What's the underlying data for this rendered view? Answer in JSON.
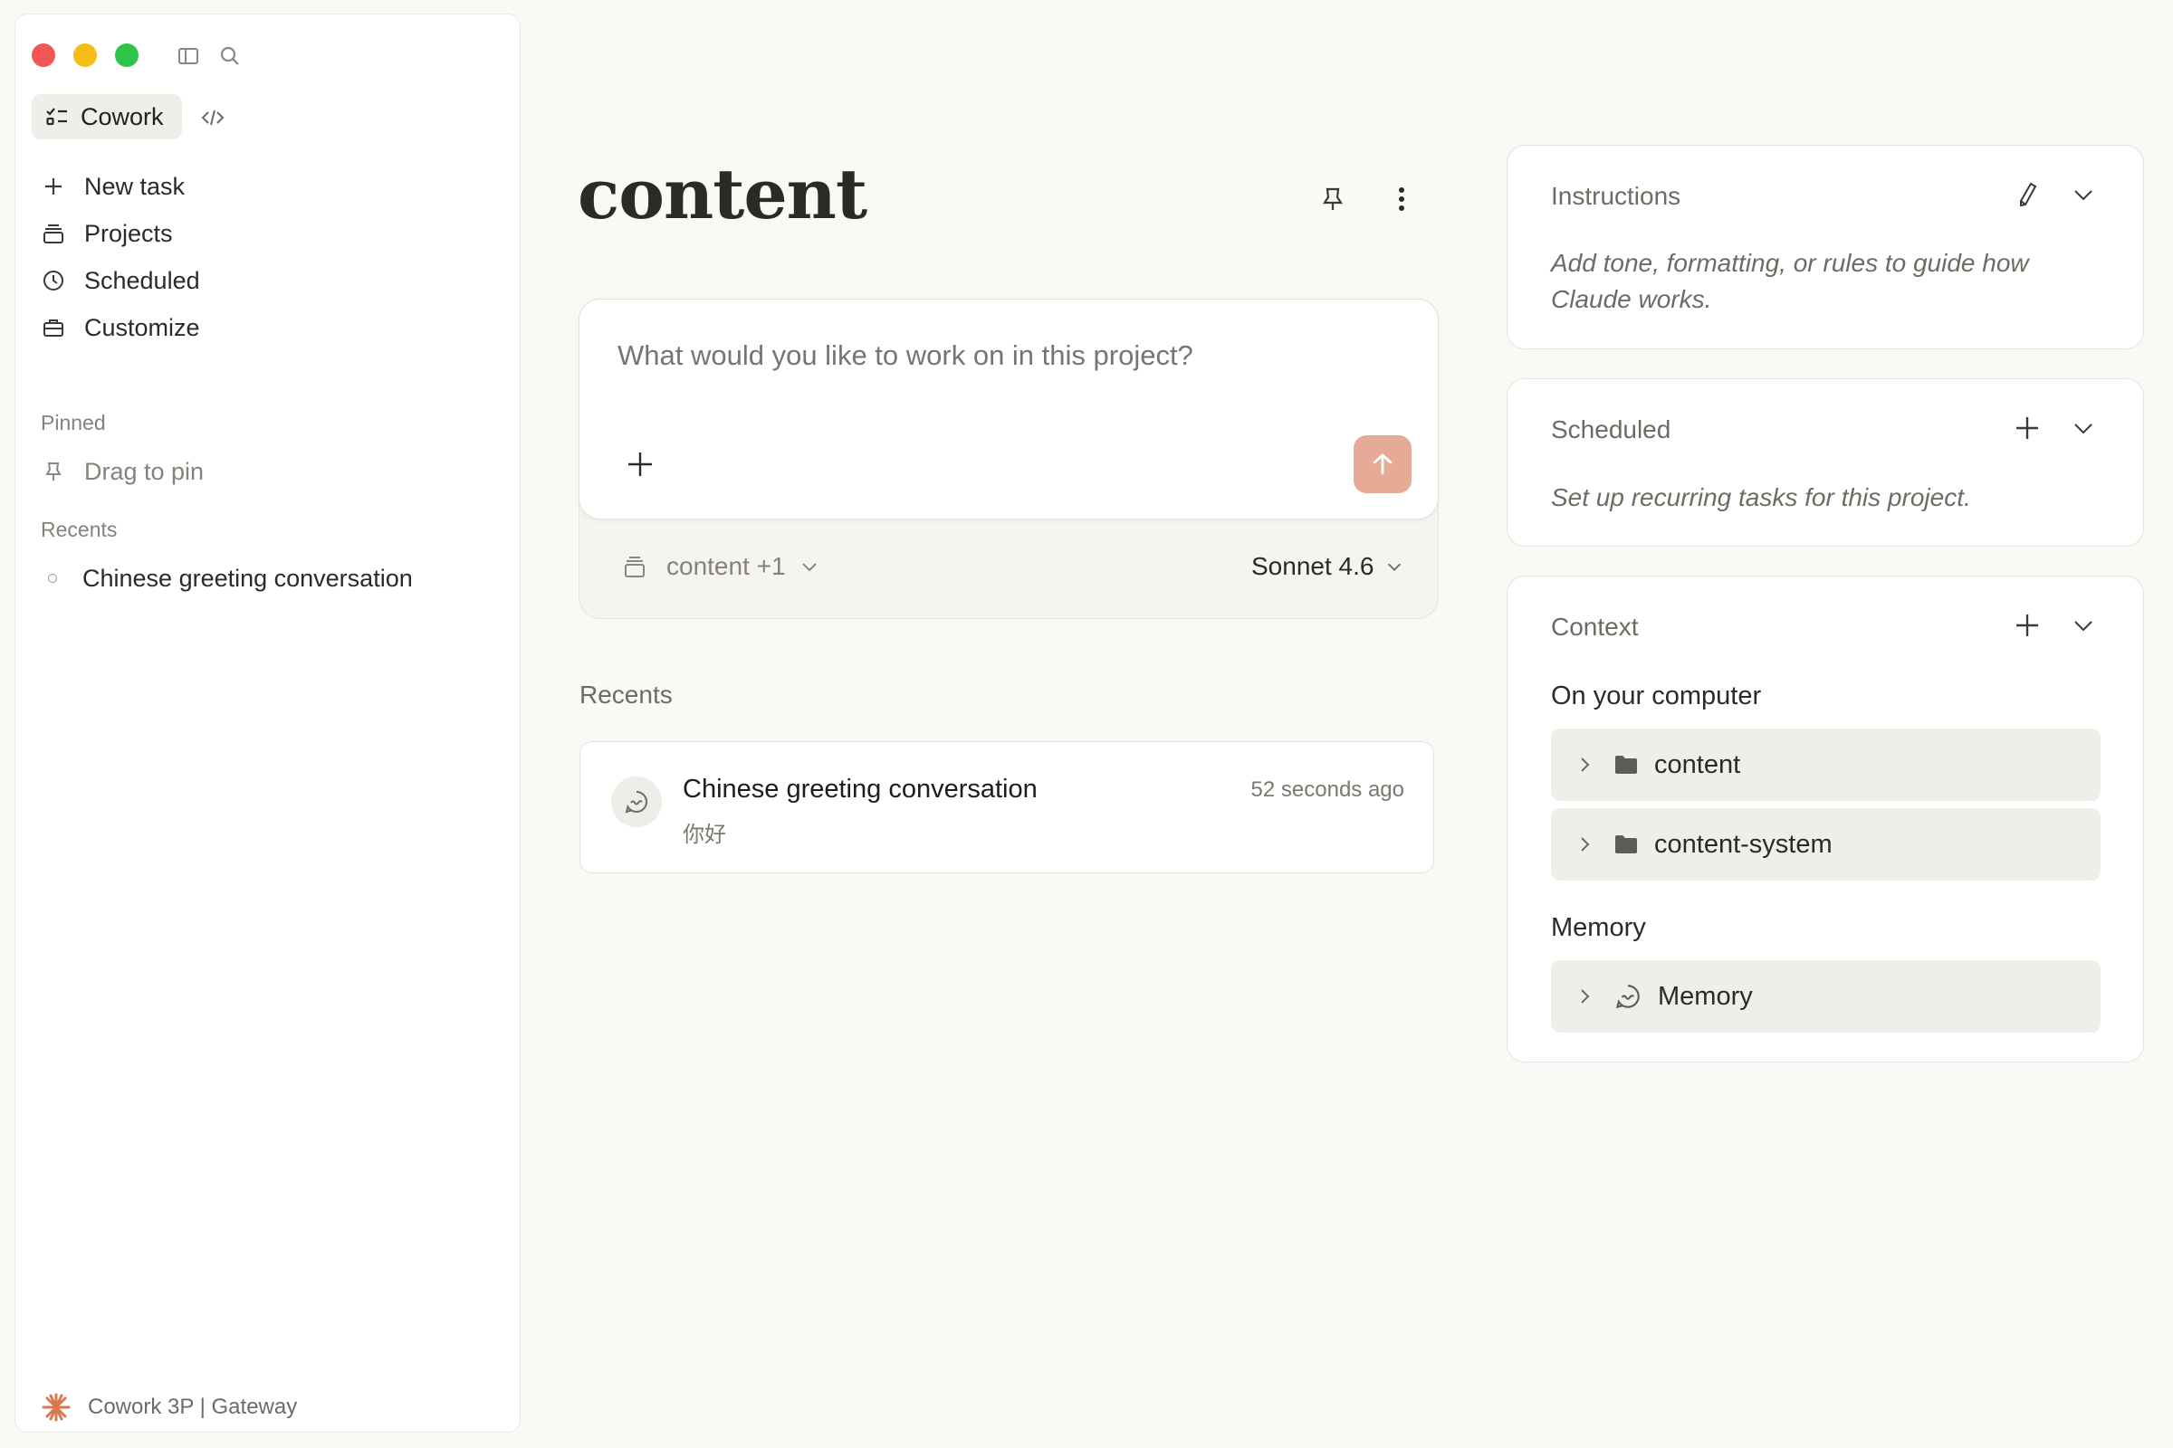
{
  "sidebar": {
    "mode_tabs": [
      {
        "label": "Cowork",
        "icon": "checklist-icon",
        "active": true
      },
      {
        "label": "",
        "icon": "code-icon",
        "active": false
      }
    ],
    "nav": [
      {
        "label": "New task",
        "icon": "plus-icon"
      },
      {
        "label": "Projects",
        "icon": "projects-icon"
      },
      {
        "label": "Scheduled",
        "icon": "clock-icon"
      },
      {
        "label": "Customize",
        "icon": "briefcase-icon"
      }
    ],
    "pinned_label": "Pinned",
    "pinned_placeholder": "Drag to pin",
    "recents_label": "Recents",
    "recents": [
      {
        "label": "Chinese greeting conversation"
      }
    ],
    "footer": "Cowork 3P | Gateway"
  },
  "main": {
    "title": "content",
    "composer": {
      "placeholder": "What would you like to work on in this project?",
      "project_chip": "content +1",
      "model": "Sonnet 4.6",
      "send_color": "#e6ab97"
    },
    "recents_label": "Recents",
    "recents": [
      {
        "title": "Chinese greeting conversation",
        "subtitle": "你好",
        "time": "52 seconds ago"
      }
    ]
  },
  "panels": {
    "instructions": {
      "title": "Instructions",
      "description": "Add tone, formatting, or rules to guide how Claude works."
    },
    "scheduled": {
      "title": "Scheduled",
      "description": "Set up recurring tasks for this project."
    },
    "context": {
      "title": "Context",
      "computer_heading": "On your computer",
      "folders": [
        {
          "label": "content",
          "icon": "folder-icon"
        },
        {
          "label": "content-system",
          "icon": "folder-icon"
        }
      ],
      "memory_heading": "Memory",
      "memory_items": [
        {
          "label": "Memory",
          "icon": "memory-icon"
        }
      ]
    }
  },
  "colors": {
    "accent": "#e6ab97",
    "background": "#faf9f6",
    "traffic_red": "#f25757",
    "traffic_yellow": "#f6bd19",
    "traffic_green": "#2ec449"
  }
}
